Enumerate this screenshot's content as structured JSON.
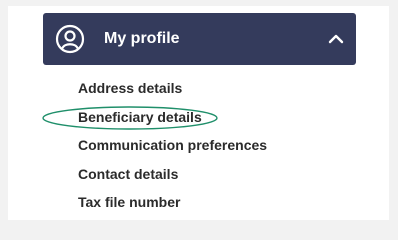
{
  "menu": {
    "title": "My profile",
    "header_color": "#343b5c",
    "items": [
      {
        "label": "Address details"
      },
      {
        "label": "Beneficiary details",
        "highlighted": true
      },
      {
        "label": "Communication preferences"
      },
      {
        "label": "Contact details"
      },
      {
        "label": "Tax file number"
      }
    ]
  },
  "icons": {
    "avatar": "user-circle-icon",
    "toggle": "chevron-up-icon"
  },
  "highlight_color": "#1f8f6a"
}
